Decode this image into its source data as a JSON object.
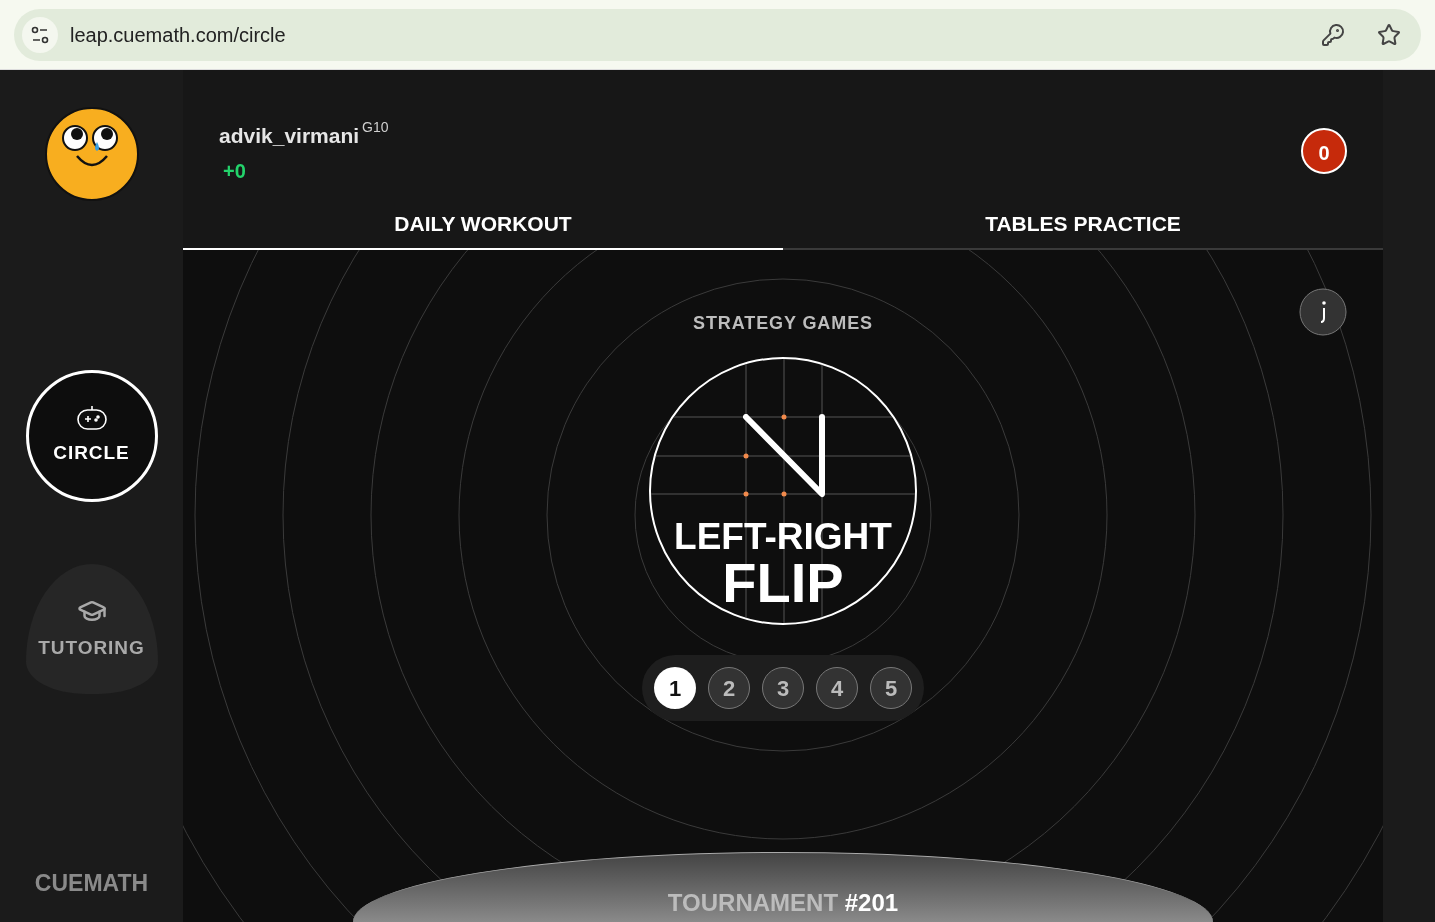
{
  "browser": {
    "url": "leap.cuemath.com/circle"
  },
  "sidebar": {
    "nav": [
      {
        "label": "CIRCLE",
        "kind": "games",
        "selected": true
      },
      {
        "label": "TUTORING",
        "kind": "tutoring",
        "selected": false
      }
    ],
    "brand": "CUEMATH"
  },
  "profile": {
    "username": "advik_virmani",
    "grade": "G10",
    "points": "+0"
  },
  "streak": {
    "count": "0"
  },
  "tabs": [
    {
      "label": "DAILY WORKOUT",
      "selected": true
    },
    {
      "label": "TABLES PRACTICE",
      "selected": false
    }
  ],
  "game": {
    "category": "STRATEGY GAMES",
    "title_line_1": "LEFT-RIGHT",
    "title_line_2": "FLIP"
  },
  "levels": [
    {
      "label": "1",
      "selected": true
    },
    {
      "label": "2",
      "selected": false
    },
    {
      "label": "3",
      "selected": false
    },
    {
      "label": "4",
      "selected": false
    },
    {
      "label": "5",
      "selected": false
    }
  ],
  "tournament": {
    "label": "TOURNAMENT **#201**"
  }
}
